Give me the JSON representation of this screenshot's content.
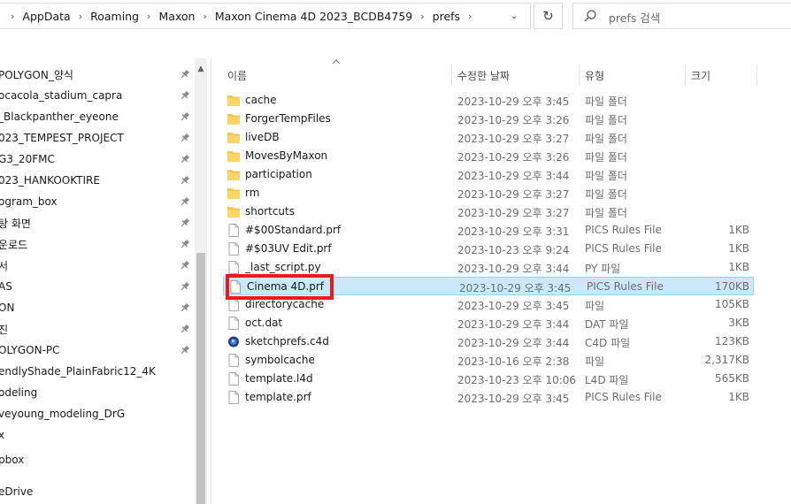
{
  "address": {
    "crumbs": [
      "AppData",
      "Roaming",
      "Maxon",
      "Maxon Cinema 4D 2023_BCDB4759",
      "prefs"
    ]
  },
  "search": {
    "placeholder": "prefs 검색"
  },
  "nav": {
    "items": [
      {
        "label": "POLYGON_양식",
        "pinned": true
      },
      {
        "label": "ocacola_stadium_capra",
        "pinned": true
      },
      {
        "label": "_Blackpanther_eyeone",
        "pinned": true
      },
      {
        "label": "023_TEMPEST_PROJECT",
        "pinned": true
      },
      {
        "label": "G3_20FMC",
        "pinned": true
      },
      {
        "label": "023_HANKOOKTIRE",
        "pinned": true
      },
      {
        "label": "ogram_box",
        "pinned": true
      },
      {
        "label": "탕 화면",
        "pinned": true
      },
      {
        "label": "운로드",
        "pinned": true
      },
      {
        "label": "서",
        "pinned": true
      },
      {
        "label": "AS",
        "pinned": true
      },
      {
        "label": "ON",
        "pinned": true
      },
      {
        "label": "진",
        "pinned": true
      },
      {
        "label": "OLYGON-PC",
        "pinned": true
      },
      {
        "label": "endlyShade_PlainFabric12_4K",
        "pinned": false
      },
      {
        "label": "odeling",
        "pinned": false
      },
      {
        "label": "veyoung_modeling_DrG",
        "pinned": false
      },
      {
        "label": "x",
        "pinned": false
      },
      {
        "label": "pbox",
        "pinned": false
      },
      {
        "label": "eDrive",
        "pinned": false
      }
    ]
  },
  "columns": {
    "name": "이름",
    "date": "수정한 날짜",
    "type": "유형",
    "size": "크기"
  },
  "files": [
    {
      "name": "cache",
      "date": "2023-10-29 오후 3:45",
      "type": "파일 폴더",
      "size": "",
      "icon": "folder-icon"
    },
    {
      "name": "ForgerTempFiles",
      "date": "2023-10-29 오후 3:26",
      "type": "파일 폴더",
      "size": "",
      "icon": "folder-icon"
    },
    {
      "name": "liveDB",
      "date": "2023-10-29 오후 3:27",
      "type": "파일 폴더",
      "size": "",
      "icon": "folder-icon"
    },
    {
      "name": "MovesByMaxon",
      "date": "2023-10-29 오후 3:26",
      "type": "파일 폴더",
      "size": "",
      "icon": "folder-icon"
    },
    {
      "name": "participation",
      "date": "2023-10-29 오후 3:44",
      "type": "파일 폴더",
      "size": "",
      "icon": "folder-icon"
    },
    {
      "name": "rm",
      "date": "2023-10-29 오후 3:27",
      "type": "파일 폴더",
      "size": "",
      "icon": "folder-icon"
    },
    {
      "name": "shortcuts",
      "date": "2023-10-29 오후 3:27",
      "type": "파일 폴더",
      "size": "",
      "icon": "folder-icon"
    },
    {
      "name": "#$00Standard.prf",
      "date": "2023-10-29 오후 3:31",
      "type": "PICS Rules File",
      "size": "1KB",
      "icon": "file-icon"
    },
    {
      "name": "#$03UV Edit.prf",
      "date": "2023-10-23 오후 9:24",
      "type": "PICS Rules File",
      "size": "1KB",
      "icon": "file-icon"
    },
    {
      "name": "_last_script.py",
      "date": "2023-10-29 오후 3:44",
      "type": "PY 파일",
      "size": "1KB",
      "icon": "file-icon"
    },
    {
      "name": "Cinema 4D.prf",
      "date": "2023-10-29 오후 3:45",
      "type": "PICS Rules File",
      "size": "170KB",
      "icon": "file-icon",
      "selected": true
    },
    {
      "name": "directorycache",
      "date": "2023-10-29 오후 3:45",
      "type": "파일",
      "size": "105KB",
      "icon": "file-icon"
    },
    {
      "name": "oct.dat",
      "date": "2023-10-29 오후 3:44",
      "type": "DAT 파일",
      "size": "3KB",
      "icon": "file-icon"
    },
    {
      "name": "sketchprefs.c4d",
      "date": "2023-10-29 오후 3:44",
      "type": "C4D 파일",
      "size": "123KB",
      "icon": "c4d-icon"
    },
    {
      "name": "symbolcache",
      "date": "2023-10-16 오후 2:38",
      "type": "파일",
      "size": "2,317KB",
      "icon": "file-icon"
    },
    {
      "name": "template.l4d",
      "date": "2023-10-23 오후 10:06",
      "type": "L4D 파일",
      "size": "565KB",
      "icon": "file-icon"
    },
    {
      "name": "template.prf",
      "date": "2023-10-29 오후 3:45",
      "type": "PICS Rules File",
      "size": "1KB",
      "icon": "file-icon"
    }
  ],
  "colors": {
    "selection_bg": "#cce8ff",
    "selection_border": "#99d1ff",
    "highlight": "#e81c1c",
    "folder": "#ffc83d"
  }
}
